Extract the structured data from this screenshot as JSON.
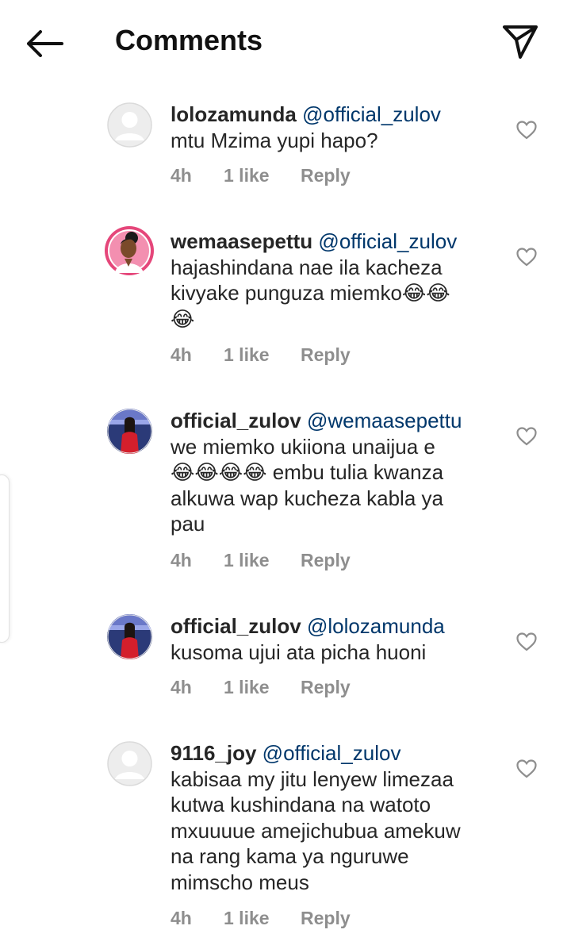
{
  "header": {
    "title": "Comments",
    "back_icon": "arrow-left-icon",
    "share_icon": "paper-plane-icon"
  },
  "comments": [
    {
      "username": "lolozamunda",
      "mention": "@official_zulov",
      "line_parts": [
        "mtu Mzima yupi hapo?"
      ],
      "time": "4h",
      "likes": "1 like",
      "reply": "Reply",
      "avatar": "default-avatar"
    },
    {
      "username": "wemaasepettu",
      "mention": "@official_zulov",
      "line_parts": [
        "hajashindana nae ila kacheza",
        "kivyake punguza miemko😂😂",
        "😂"
      ],
      "time": "4h",
      "likes": "1 like",
      "reply": "Reply",
      "avatar": "cartoon-woman-avatar"
    },
    {
      "username": "official_zulov",
      "mention": "@wemaasepettu",
      "line_parts": [
        "we miemko ukiiona unaijua e",
        "😂😂😂😂 embu tulia kwanza",
        "alkuwa wap kucheza kabla ya",
        "pau"
      ],
      "time": "4h",
      "likes": "1 like",
      "reply": "Reply",
      "avatar": "photo-avatar"
    },
    {
      "username": "official_zulov",
      "mention": "@lolozamunda",
      "line_parts": [
        "kusoma ujui ata picha huoni"
      ],
      "time": "4h",
      "likes": "1 like",
      "reply": "Reply",
      "avatar": "photo-avatar"
    },
    {
      "username": "9116_joy",
      "mention": "@official_zulov",
      "line_parts": [
        "kabisaa my jitu lenyew limezaa",
        "kutwa kushindana na watoto",
        "mxuuuue amejichubua amekuw",
        "na rang kama ya nguruwe",
        "mimscho meus"
      ],
      "time": "4h",
      "likes": "1 like",
      "reply": "Reply",
      "avatar": "default-avatar"
    }
  ],
  "colors": {
    "text": "#262626",
    "mention": "#00376b",
    "meta": "#8e8e8e",
    "icon": "#262626"
  }
}
